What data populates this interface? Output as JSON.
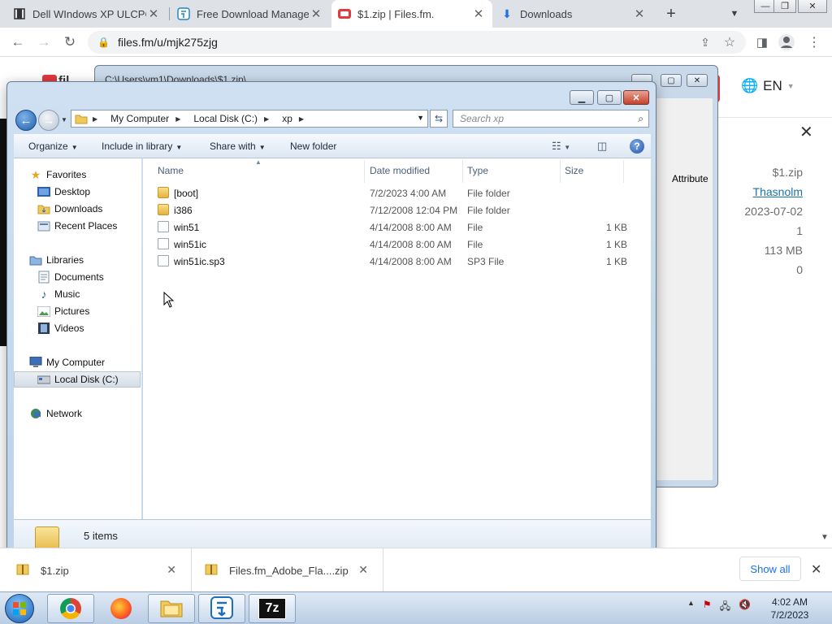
{
  "browser": {
    "tabs": [
      {
        "title": "Dell WIndows XP ULCPC",
        "icon": "film-icon"
      },
      {
        "title": "Free Download Manager",
        "icon": "fdm-icon"
      },
      {
        "title": "$1.zip | Files.fm.",
        "icon": "filesfm-icon"
      },
      {
        "title": "Downloads",
        "icon": "download-icon"
      }
    ],
    "url": "files.fm/u/mjk275zjg"
  },
  "page_behind": {
    "lang": "EN",
    "file_info": [
      "$1.zip",
      "Thasnolm",
      "2023-07-02",
      "1",
      "113 MB",
      "0"
    ]
  },
  "zip_window": {
    "title": "C:\\Users\\vm1\\Downloads\\$1.zip\\",
    "column_attribute": "Attribute"
  },
  "explorer": {
    "breadcrumb": [
      "My Computer",
      "Local Disk (C:)",
      "xp"
    ],
    "search_placeholder": "Search xp",
    "toolbar": {
      "organize": "Organize",
      "include_in_library": "Include in library",
      "share_with": "Share with",
      "new_folder": "New folder"
    },
    "nav": {
      "favorites": "Favorites",
      "desktop": "Desktop",
      "downloads": "Downloads",
      "recent_places": "Recent Places",
      "libraries": "Libraries",
      "documents": "Documents",
      "music": "Music",
      "pictures": "Pictures",
      "videos": "Videos",
      "my_computer": "My Computer",
      "local_disk": "Local Disk (C:)",
      "network": "Network"
    },
    "columns": {
      "name": "Name",
      "date": "Date modified",
      "type": "Type",
      "size": "Size"
    },
    "files": [
      {
        "name": "[boot]",
        "date": "7/2/2023 4:00 AM",
        "type": "File folder",
        "size": "",
        "kind": "folder"
      },
      {
        "name": "i386",
        "date": "7/12/2008 12:04 PM",
        "type": "File folder",
        "size": "",
        "kind": "folder"
      },
      {
        "name": "win51",
        "date": "4/14/2008 8:00 AM",
        "type": "File",
        "size": "1 KB",
        "kind": "file"
      },
      {
        "name": "win51ic",
        "date": "4/14/2008 8:00 AM",
        "type": "File",
        "size": "1 KB",
        "kind": "file"
      },
      {
        "name": "win51ic.sp3",
        "date": "4/14/2008 8:00 AM",
        "type": "SP3 File",
        "size": "1 KB",
        "kind": "file"
      }
    ],
    "item_count": "5 items"
  },
  "downloads_bar": {
    "items": [
      "$1.zip",
      "Files.fm_Adobe_Fla....zip"
    ],
    "show_all": "Show all"
  },
  "taskbar": {
    "time": "4:02 AM",
    "date": "7/2/2023",
    "seven_zip_label": "7z"
  },
  "colors": {
    "chrome_tabbar": "#dee1e6",
    "explorer_frame": "#c4d8ee",
    "link_blue": "#1a73a8",
    "accent_red": "#e0393e"
  }
}
